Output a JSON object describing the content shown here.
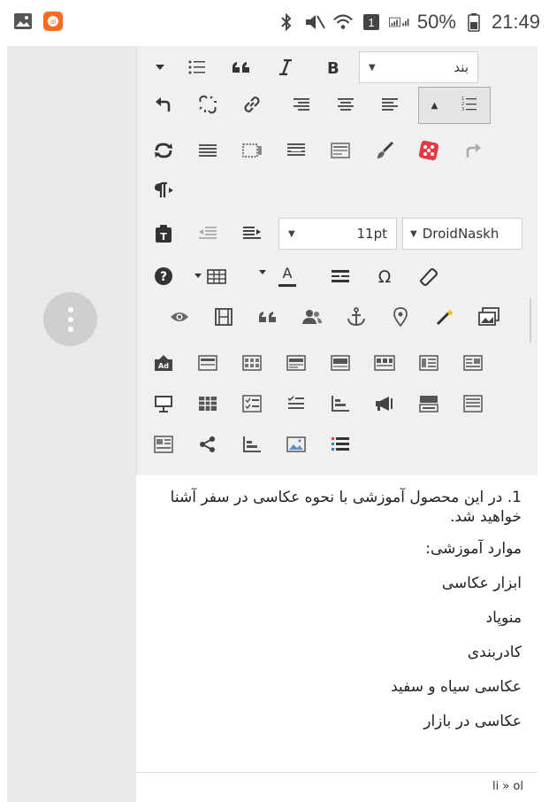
{
  "status_bar": {
    "battery": "50%",
    "time": "21:49",
    "notification_badge": "1"
  },
  "toolbar": {
    "format_select": {
      "value": "بند"
    },
    "font_size_select": {
      "value": "11pt"
    },
    "font_family_select": {
      "value": "DroidNaskh"
    },
    "buttons": [
      "list-dropdown-icon",
      "bullet-list-icon",
      "blockquote-icon",
      "italic-icon",
      "bold-icon",
      "undo-icon",
      "unlink-icon",
      "link-icon",
      "align-right-icon",
      "align-center-icon",
      "align-left-icon",
      "numbered-list-icon",
      "refresh-icon",
      "horizontal-rule-icon",
      "fullscreen-icon",
      "justify-icon",
      "template-icon",
      "paint-brush-icon",
      "dice-icon",
      "redo-icon",
      "paragraph-direction-icon",
      "clipboard-icon",
      "outdent-icon",
      "indent-icon",
      "help-icon",
      "table-icon",
      "text-color-icon",
      "strikeline-icon",
      "omega-icon",
      "eraser-icon",
      "preview-icon",
      "media-icon",
      "quote-icon",
      "users-icon",
      "anchor-icon",
      "location-icon",
      "magic-wand-icon",
      "gallery-icon",
      "ad-icon",
      "layout-1-icon",
      "layout-2-icon",
      "layout-3-icon",
      "layout-4-icon",
      "layout-5-icon",
      "layout-6-icon",
      "layout-7-icon",
      "slideshow-icon",
      "grid-icon",
      "checklist-icon",
      "checklist-2-icon",
      "chart-icon",
      "megaphone-icon",
      "layout-8-icon",
      "layout-9-icon",
      "news-icon",
      "share-icon",
      "bar-chart-icon",
      "image-icon",
      "colored-list-icon"
    ]
  },
  "content": {
    "first_item": "1. در این محصول آموزشی با نحوه عکاسی در سفر آشنا خواهید شد.",
    "heading": "موارد آموزشی:",
    "items": [
      "ابزار عکاسی",
      "منوپاد",
      "کادربندی",
      "عکاسی سیاه و سفید",
      "عکاسی در بازار"
    ]
  },
  "path": "li » ol",
  "colors": {
    "toolbar_bg": "#f0f0f0",
    "side_panel_bg": "#e9e9e9",
    "dice_red": "#e53945",
    "notif_orange": "#ff6d22"
  }
}
